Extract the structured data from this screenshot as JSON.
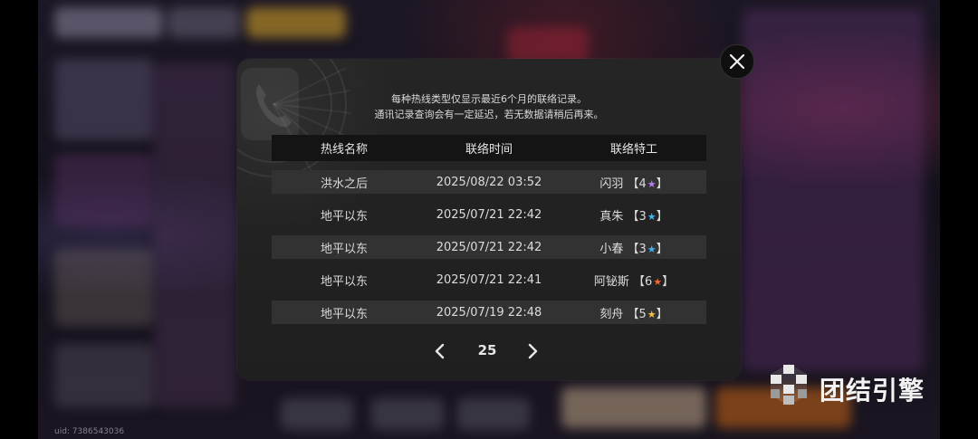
{
  "uid_label": "uid: 7386543036",
  "dialog": {
    "notice_line1": "每种热线类型仅显示最近6个月的联络记录。",
    "notice_line2": "通讯记录查询会有一定延迟，若无数据请稍后再来。",
    "columns": [
      "热线名称",
      "联络时间",
      "联络特工"
    ],
    "rows": [
      {
        "hotline": "洪水之后",
        "time": "2025/08/22 03:52",
        "agent": "闪羽",
        "rank_open": "【4",
        "rank_close": "】",
        "star_color": "#b77cf2"
      },
      {
        "hotline": "地平以东",
        "time": "2025/07/21 22:42",
        "agent": "真朱",
        "rank_open": "【3",
        "rank_close": "】",
        "star_color": "#3fb3f0"
      },
      {
        "hotline": "地平以东",
        "time": "2025/07/21 22:42",
        "agent": "小春",
        "rank_open": "【3",
        "rank_close": "】",
        "star_color": "#3fb3f0"
      },
      {
        "hotline": "地平以东",
        "time": "2025/07/21 22:41",
        "agent": "阿铋斯",
        "rank_open": "【6",
        "rank_close": "】",
        "star_color": "#f2652e"
      },
      {
        "hotline": "地平以东",
        "time": "2025/07/19 22:48",
        "agent": "刻舟",
        "rank_open": "【5",
        "rank_close": "】",
        "star_color": "#f0c23f"
      }
    ],
    "page": "25"
  },
  "icons": {
    "close": "close-icon",
    "prev": "chevron-left-icon",
    "next": "chevron-right-icon",
    "phone": "phone-icon",
    "brand": "cube-logo-icon",
    "star": "star-icon"
  },
  "brand": {
    "name": "团结引擎"
  },
  "colors": {
    "dialog_bg": "#222222",
    "header_bg": "#141414",
    "row_shade": "#323232",
    "text": "#dcdcdc"
  }
}
